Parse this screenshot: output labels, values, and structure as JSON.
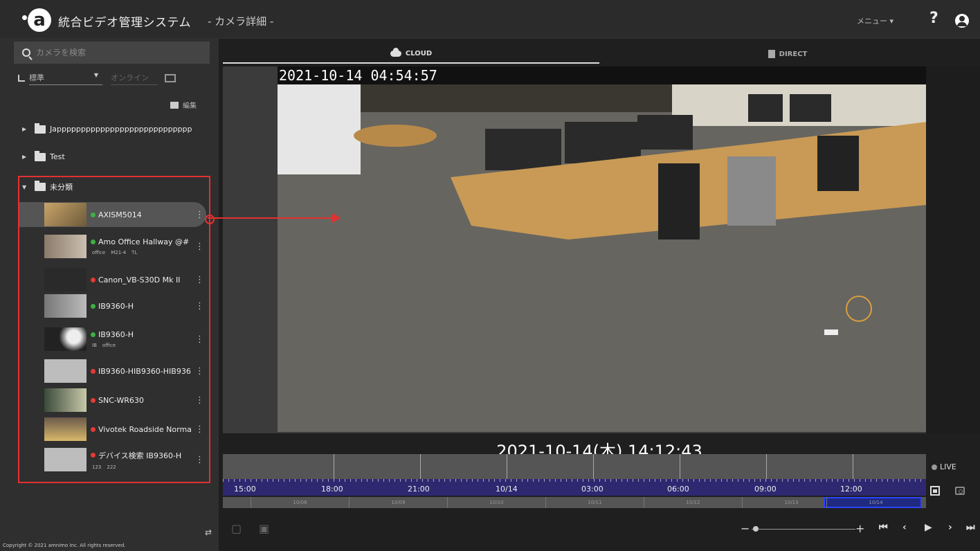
{
  "header": {
    "title": "統合ビデオ管理システム",
    "subtitle": "- カメラ詳細 -",
    "menu_label": "メニュー ▾",
    "help_label": "?",
    "logo_letter": "a"
  },
  "sidebar": {
    "search_placeholder": "カメラを検索",
    "view_select": "標準",
    "online_filter": "オンライン",
    "edit_label": "編集",
    "groups": [
      {
        "label": "Japppppppppppppppppppppppppppp",
        "expanded": false
      },
      {
        "label": "Test",
        "expanded": false
      },
      {
        "label": "未分類",
        "expanded": true
      }
    ],
    "cameras": [
      {
        "name": "AXISM5014",
        "status": "online",
        "tags": [],
        "active": true
      },
      {
        "name": "Amo Office Hallway @#",
        "status": "online",
        "tags": [
          "office",
          "M21-4",
          "TL"
        ]
      },
      {
        "name": "Canon_VB-S30D Mk II",
        "status": "offline",
        "tags": []
      },
      {
        "name": "IB9360-H",
        "status": "online",
        "tags": []
      },
      {
        "name": "IB9360-H",
        "status": "online",
        "tags": [
          "IB",
          "office"
        ]
      },
      {
        "name": "IB9360-HIB9360-HIB936",
        "status": "offline",
        "tags": []
      },
      {
        "name": "SNC-WR630",
        "status": "offline",
        "tags": []
      },
      {
        "name": "Vivotek Roadside Norma",
        "status": "offline",
        "tags": []
      },
      {
        "name": "デバイス検索 IB9360-H",
        "status": "offline",
        "tags": [
          "123",
          "222"
        ]
      }
    ],
    "copyright": "Copyright © 2021 amnimo Inc. All rights reserved."
  },
  "main": {
    "tabs": [
      {
        "label": "CLOUD",
        "active": true
      },
      {
        "label": "DIRECT",
        "active": false
      }
    ],
    "video_timestamp": "2021-10-14  04:54:57",
    "current_time": "2021-10-14(木) 14:12:43",
    "timeline": {
      "hour_labels": [
        "15:00",
        "18:00",
        "21:00",
        "10/14",
        "03:00",
        "06:00",
        "09:00",
        "12:00"
      ],
      "day_labels": [
        "10/08",
        "10/09",
        "10/10",
        "10/11",
        "10/12",
        "10/13",
        "10/14"
      ],
      "live_label": "LIVE"
    }
  },
  "colors": {
    "online": "#3cb043",
    "offline": "#e53935",
    "annotation": "#e53030",
    "timeline_band": "#2e2870",
    "timeline_selection": "#2b44ff"
  },
  "icons": {
    "search": "search-icon",
    "tree": "tree-view-icon",
    "folder": "folder-icon",
    "cloud": "cloud-icon",
    "direct": "camera-device-icon",
    "calendar": "calendar-icon",
    "snapshot": "camera-icon",
    "swap": "swap-icon"
  }
}
